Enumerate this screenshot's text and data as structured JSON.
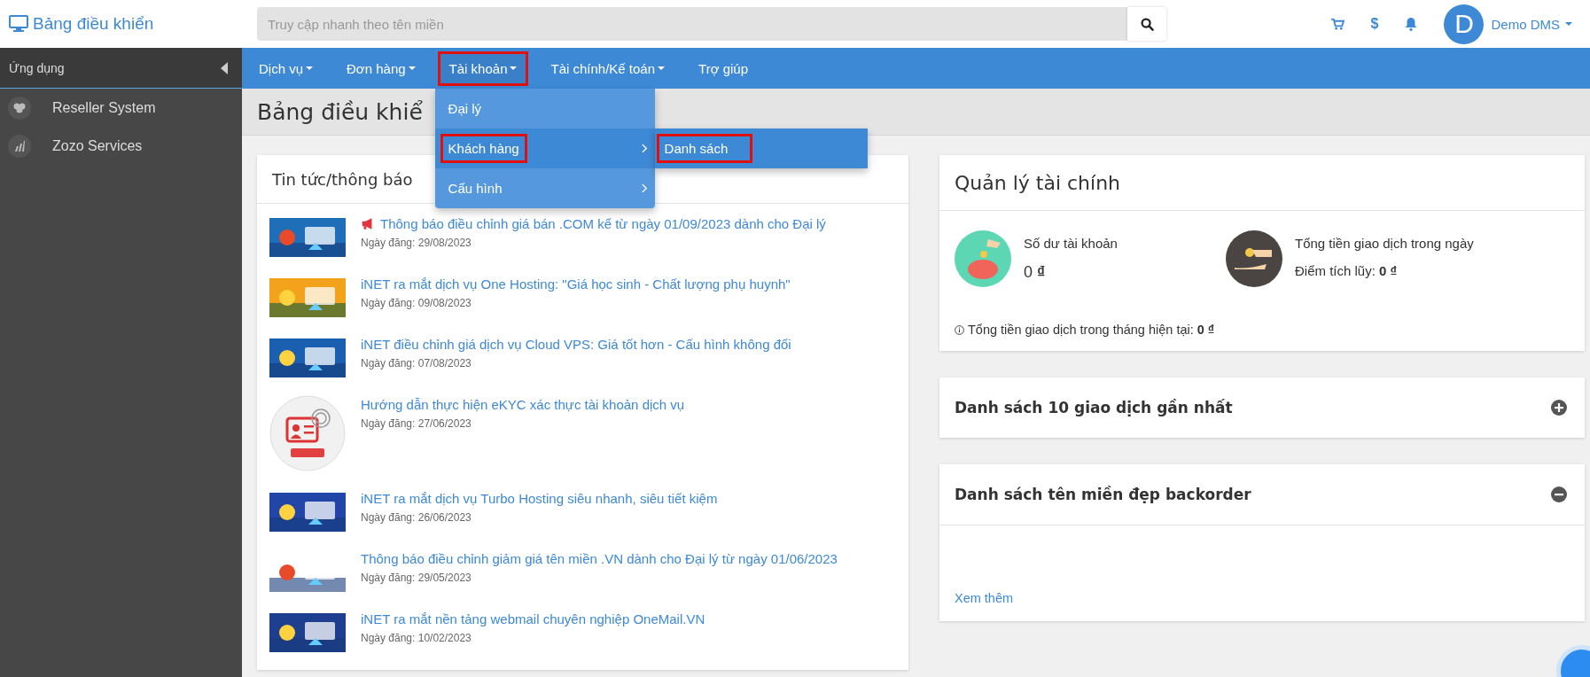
{
  "brand": {
    "title": "Bảng điều khiển"
  },
  "search": {
    "placeholder": "Truy cập nhanh theo tên miền"
  },
  "header_icons": {
    "currency": "$"
  },
  "user": {
    "initial": "D",
    "name": "Demo DMS"
  },
  "sidebar": {
    "title": "Ứng dụng",
    "items": [
      {
        "label": "Reseller System",
        "kind": "cloud"
      },
      {
        "label": "Zozo Services",
        "kind": "bars"
      }
    ]
  },
  "nav": [
    {
      "label": "Dịch vụ",
      "caret": true,
      "highlighted": false,
      "open": false
    },
    {
      "label": "Đơn hàng",
      "caret": true,
      "highlighted": false,
      "open": false
    },
    {
      "label": "Tài khoản",
      "caret": true,
      "highlighted": true,
      "open": true
    },
    {
      "label": "Tài chính/Kế toán",
      "caret": true,
      "highlighted": false,
      "open": false
    },
    {
      "label": "Trợ giúp",
      "caret": false,
      "highlighted": false,
      "open": false
    }
  ],
  "dropdown": [
    {
      "label": "Đại lý",
      "submenu": false,
      "selected": false,
      "highlighted": false
    },
    {
      "label": "Khách hàng",
      "submenu": true,
      "selected": true,
      "highlighted": true
    },
    {
      "label": "Cấu hình",
      "submenu": true,
      "selected": false,
      "highlighted": false
    }
  ],
  "submenu": [
    {
      "label": "Danh sách",
      "highlighted": true
    }
  ],
  "page_title": "Bảng điều khiể",
  "news": {
    "title": "Tin tức/thông báo",
    "items": [
      {
        "kind": "banner",
        "megaphone": true,
        "title": "Thông báo điều chỉnh giá bán .COM kể từ ngày 01/09/2023 dành cho Đại lý",
        "date": "Ngày đăng: 29/08/2023"
      },
      {
        "kind": "banner",
        "megaphone": false,
        "title": "iNET ra mắt dịch vụ One Hosting: \"Giá học sinh - Chất lượng phụ huynh\"",
        "date": "Ngày đăng: 09/08/2023"
      },
      {
        "kind": "banner",
        "megaphone": false,
        "title": "iNET điều chỉnh giá dịch vụ Cloud VPS: Giá tốt hơn - Cấu hình không đổi",
        "date": "Ngày đăng: 07/08/2023"
      },
      {
        "kind": "round",
        "megaphone": false,
        "title": "Hướng dẫn thực hiện eKYC xác thực tài khoản dịch vụ",
        "date": "Ngày đăng: 27/06/2023"
      },
      {
        "kind": "banner",
        "megaphone": false,
        "title": "iNET ra mắt dịch vụ Turbo Hosting siêu nhanh, siêu tiết kiệm",
        "date": "Ngày đăng: 26/06/2023"
      },
      {
        "kind": "banner",
        "megaphone": false,
        "title": "Thông báo điều chỉnh giảm giá tên miền .VN dành cho Đại lý từ ngày 01/06/2023",
        "date": "Ngày đăng: 29/05/2023"
      },
      {
        "kind": "banner",
        "megaphone": false,
        "title": "iNET ra mắt nền tảng webmail chuyên nghiệp OneMail.VN",
        "date": "Ngày đăng: 10/02/2023"
      }
    ]
  },
  "finance": {
    "title": "Quản lý tài chính",
    "balance": {
      "label": "Số dư tài khoản",
      "value": "0 **₫**"
    },
    "daily": {
      "label": "Tổng tiền giao dịch trong ngày",
      "points": "Điểm tích lũy: **0 ₫**"
    },
    "monthly": "Tổng tiền giao dịch trong tháng hiện tại: **0 ₫**"
  },
  "panels": [
    {
      "title": "Danh sách 10 giao dịch gần nhất",
      "expanded": false
    },
    {
      "title": "Danh sách tên miền đẹp backorder",
      "expanded": true,
      "link": "Xem thêm"
    }
  ]
}
